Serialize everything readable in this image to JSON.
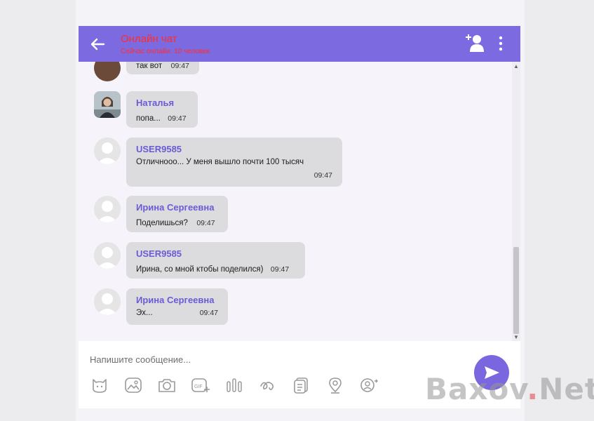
{
  "header": {
    "title": "Онлайн чат",
    "subtitle": "Сейчас онлайн: 10 человек"
  },
  "messages": [
    {
      "author": "",
      "text": "так вот",
      "time": "09:47"
    },
    {
      "author": "Наталья",
      "text": "попа...",
      "time": "09:47"
    },
    {
      "author": "USER9585",
      "text": "Отличнооо... У меня вышло почти 100 тысяч",
      "time": "09:47"
    },
    {
      "author": "Ирина Сергеевна",
      "text": "Поделишься?",
      "time": "09:47"
    },
    {
      "author": "USER9585",
      "text": "Ирина, со мной ктобы поделился)",
      "time": "09:47"
    },
    {
      "author": "Ирина Сергеевна",
      "text": "Эх...",
      "time": "09:47"
    }
  ],
  "composer": {
    "placeholder": "Напишите сообщение..."
  },
  "toolbar": {
    "icons": [
      "sticker-icon",
      "image-icon",
      "camera-icon",
      "gif-icon",
      "audio-icon",
      "doodle-icon",
      "file-icon",
      "location-icon",
      "contact-icon"
    ]
  },
  "watermark": {
    "left": "Baxov",
    "dot": ".",
    "right": "Net"
  },
  "colors": {
    "accent": "#7c6ae0",
    "bubble": "#dcdbdd",
    "author": "#6a5bd7",
    "title_red": "#ff2d2d"
  }
}
